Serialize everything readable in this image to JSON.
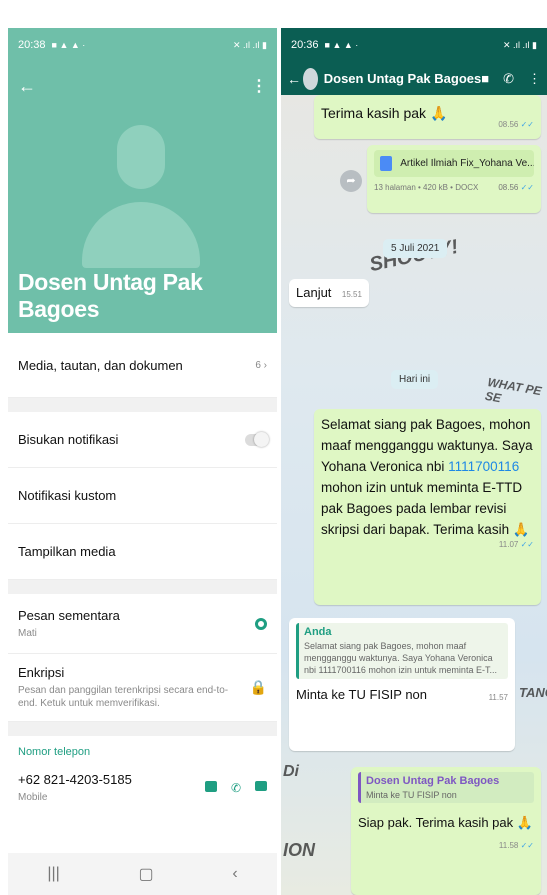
{
  "left": {
    "status_time": "20:38",
    "status_icons_left": "■ ▲ ▲ ·",
    "status_icons_right": "✕ .ıl .ıl ▮",
    "contact_name": "Dosen Untag Pak Bagoes",
    "media_label": "Media, tautan, dan dokumen",
    "media_count": "6 ›",
    "mute_label": "Bisukan notifikasi",
    "custom_notif_label": "Notifikasi kustom",
    "show_media_label": "Tampilkan media",
    "disappearing_label": "Pesan sementara",
    "disappearing_value": "Mati",
    "encryption_label": "Enkripsi",
    "encryption_desc": "Pesan dan panggilan terenkripsi secara end-to-end. Ketuk untuk memverifikasi.",
    "phone_section_label": "Nomor telepon",
    "phone_number": "+62 821-4203-5185",
    "phone_type": "Mobile"
  },
  "right": {
    "status_time": "20:36",
    "status_icons_left": "■ ▲ ▲ ·",
    "status_icons_right": "✕ .ıl .ıl ▮",
    "chat_title": "Dosen Untag Pak Bagoes",
    "msg1_text": "Terima kasih pak",
    "msg1_time": "08.56",
    "doc_name": "Artikel Ilmiah Fix_Yohana Ve...",
    "doc_meta": "13 halaman • 420 kB • DOCX",
    "doc_time": "08.56",
    "date_chip_1": "5 Juli 2021",
    "msg2_text": "Lanjut",
    "msg2_time": "15.51",
    "date_chip_2": "Hari ini",
    "msg3_before": "Selamat siang pak Bagoes, mohon maaf mengganggu waktunya. Saya Yohana Veronica nbi ",
    "msg3_nbi": "1111700116",
    "msg3_after": " mohon izin untuk meminta E-TTD pak Bagoes pada lembar revisi skripsi dari bapak. Terima kasih",
    "msg3_time": "11.07",
    "quote1_author": "Anda",
    "quote1_text": "Selamat siang pak Bagoes, mohon maaf mengganggu waktunya. Saya Yohana Veronica nbi 1111700116 mohon izin untuk meminta E-T...",
    "msg4_text": "Minta ke TU FISIP non",
    "msg4_time": "11.57",
    "quote2_author": "Dosen Untag Pak Bagoes",
    "quote2_text": "Minta ke TU FISIP non",
    "msg5_text": "Siap pak. Terima kasih pak",
    "msg5_time": "11.58",
    "ticks": "✓✓",
    "emoji": "🙏",
    "doodle_1": "SHOUTY!",
    "doodle_2": "WHAT PE SE",
    "doodle_3": "TANCE",
    "doodle_4": "Di",
    "doodle_5": "ION"
  },
  "colors": {
    "teal_header": "#6fbfa9",
    "chat_header": "#0b5e53",
    "outgoing_bubble": "#dff7c4",
    "accent": "#1f9e82"
  }
}
